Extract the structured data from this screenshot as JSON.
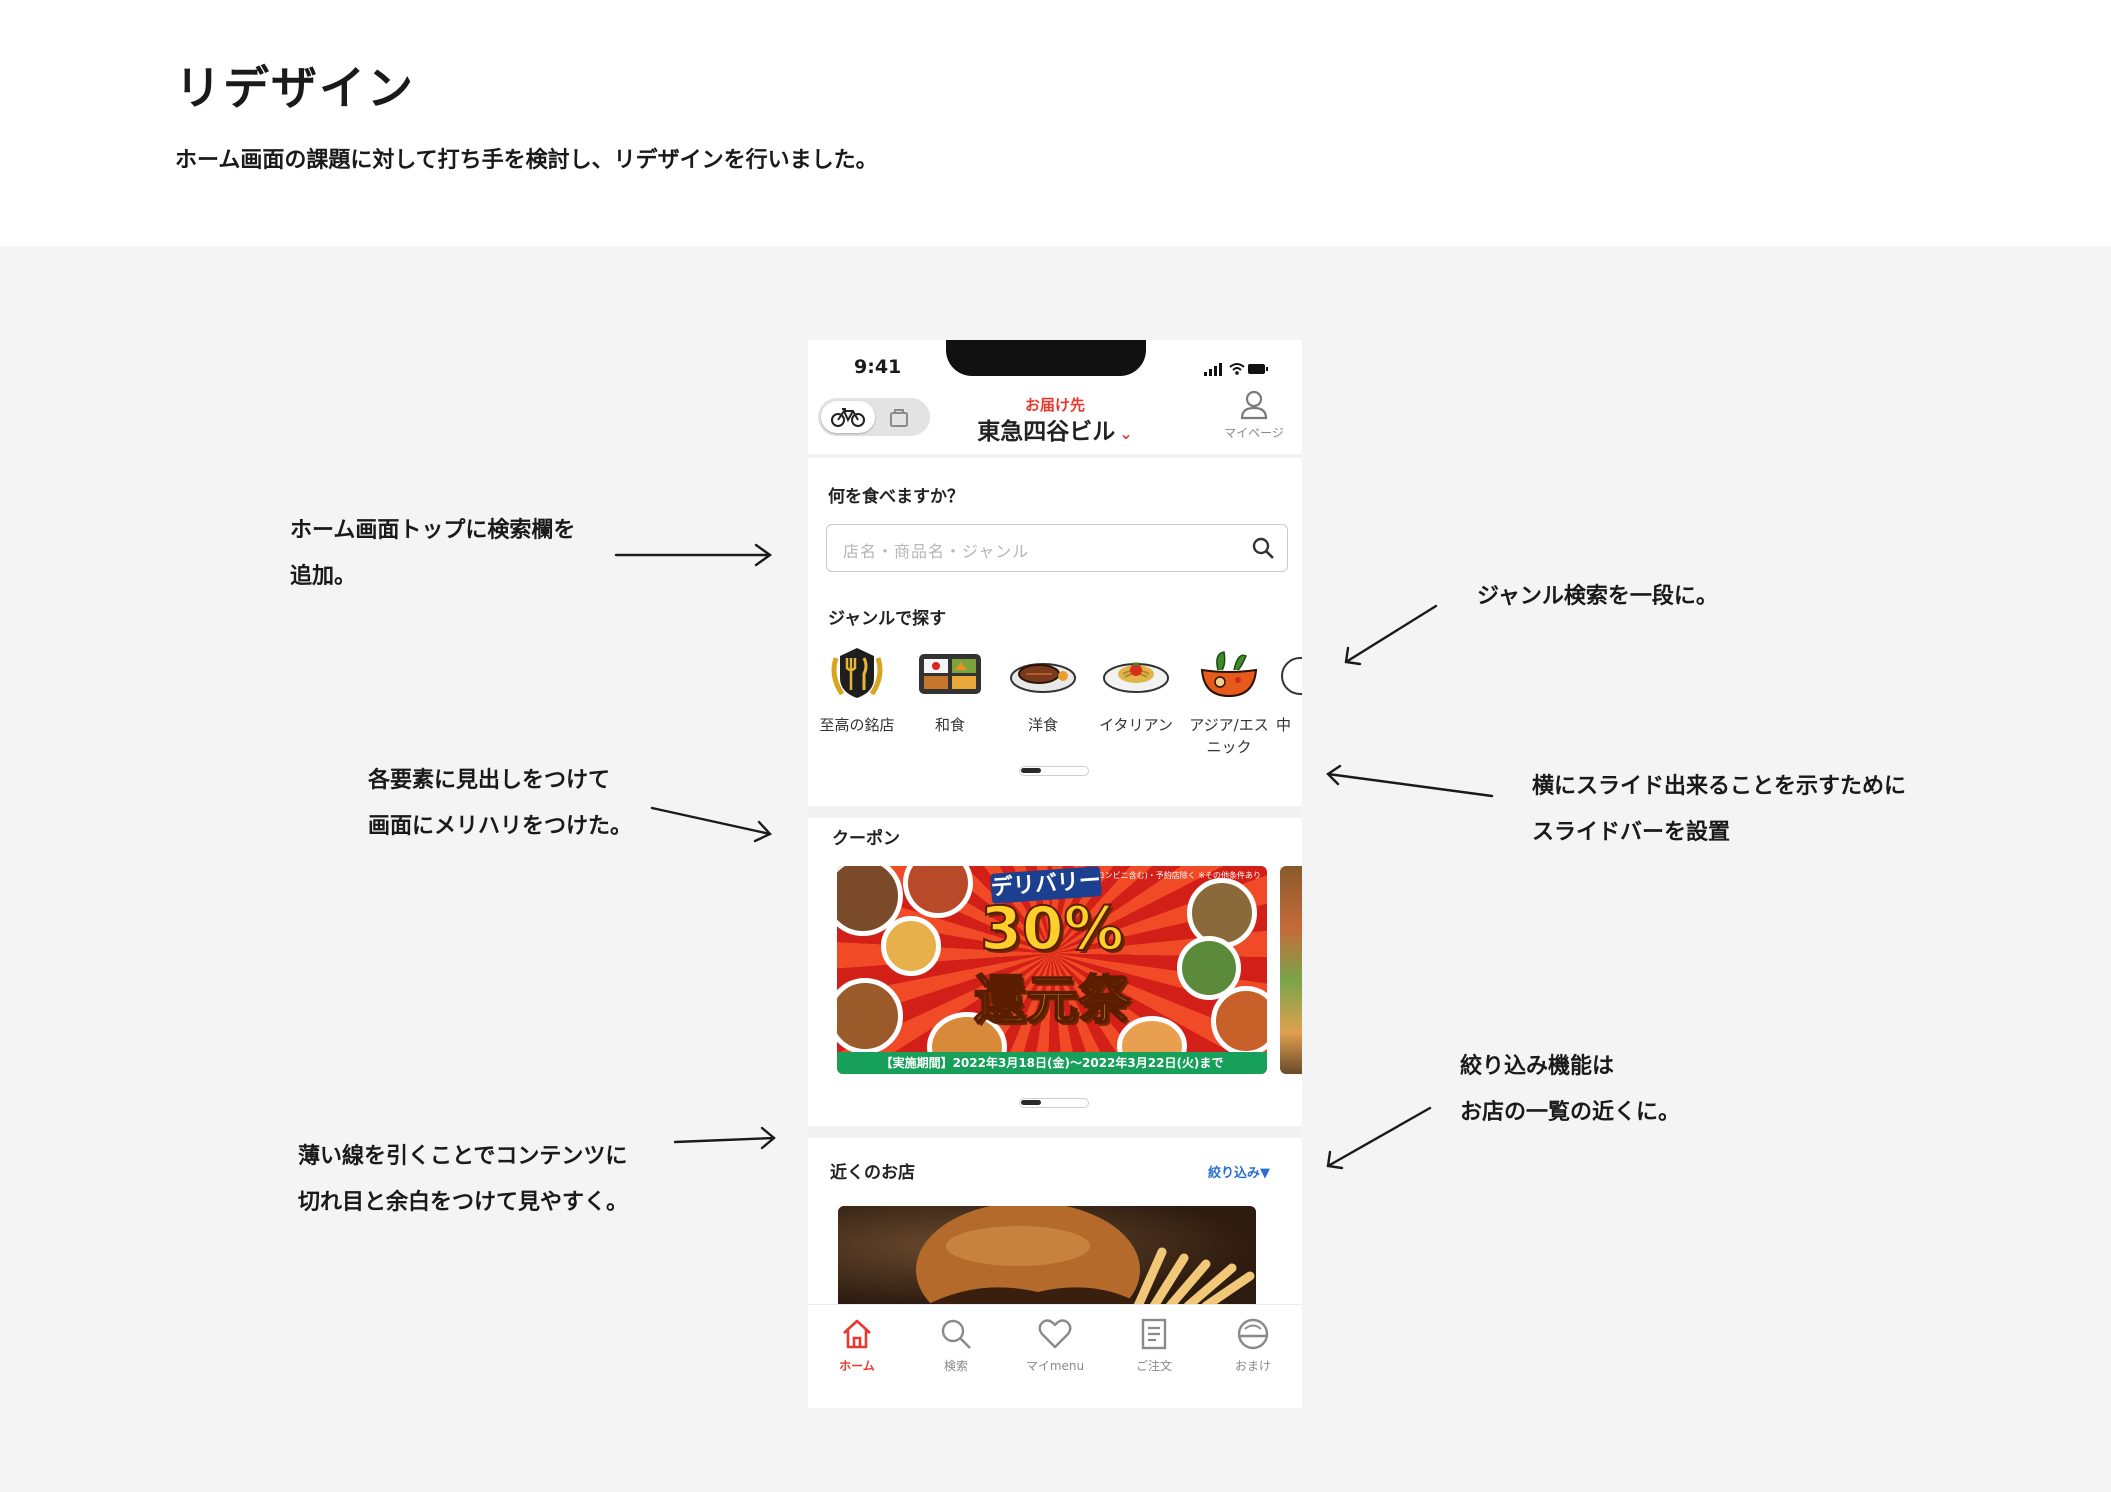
{
  "page": {
    "title": "リデザイン",
    "description": "ホーム画面の課題に対して打ち手を検討し、リデザインを行いました。"
  },
  "annotations": [
    {
      "line1": "ホーム画面トップに検索欄を",
      "line2": "追加。"
    },
    {
      "line1": "ジャンル検索を一段に。",
      "line2": ""
    },
    {
      "line1": "各要素に見出しをつけて",
      "line2": "画面にメリハリをつけた。"
    },
    {
      "line1": "横にスライド出来ることを示すために",
      "line2": "スライドバーを設置"
    },
    {
      "line1": "絞り込み機能は",
      "line2": "お店の一覧の近くに。"
    },
    {
      "line1": "薄い線を引くことでコンテンツに",
      "line2": "切れ目と余白をつけて見やすく。"
    }
  ],
  "phone": {
    "status": {
      "time": "9:41"
    },
    "header": {
      "mode_toggle": {
        "selected": "bike-icon",
        "other": "bag-icon"
      },
      "address_label": "お届け先",
      "address_name": "東急四谷ビル",
      "address_chevron": "⌄",
      "mypage_label": "マイページ"
    },
    "search": {
      "heading": "何を食べますか？",
      "placeholder": "店名・商品名・ジャンル"
    },
    "genres": {
      "heading": "ジャンルで探す",
      "items": [
        {
          "label": "至高の銘店",
          "icon": "laurel-fork-knife-icon"
        },
        {
          "label": "和食",
          "icon": "bento-icon"
        },
        {
          "label": "洋食",
          "icon": "steak-plate-icon"
        },
        {
          "label": "イタリアン",
          "icon": "pasta-plate-icon"
        },
        {
          "label": "アジア/エスニック",
          "icon": "asian-bowl-icon"
        },
        {
          "label": "中",
          "icon": "partial-icon"
        }
      ],
      "scroll_position": 0.3
    },
    "coupon": {
      "heading": "クーポン",
      "banner": {
        "note": "※小売店(コンビニ含む)・予約店除く ※その他条件あり",
        "subtitle": "デリバリー",
        "headline": "30%",
        "headline2": "還元祭",
        "period": "【実施期間】2022年3月18日(金)〜2022年3月22日(火)まで"
      },
      "scroll_position": 0.3
    },
    "nearby": {
      "heading": "近くのお店",
      "filter_label": "絞り込み▼"
    },
    "tabbar": {
      "tabs": [
        {
          "label": "ホーム",
          "icon": "home-icon",
          "active": true
        },
        {
          "label": "検索",
          "icon": "search-icon",
          "active": false
        },
        {
          "label": "マイmenu",
          "icon": "heart-icon",
          "active": false
        },
        {
          "label": "ご注文",
          "icon": "receipt-icon",
          "active": false
        },
        {
          "label": "おまけ",
          "icon": "bonus-icon",
          "active": false
        }
      ]
    }
  },
  "colors": {
    "accent": "#e8392f",
    "filter_link": "#2a6fcf",
    "background": "#f4f4f4"
  }
}
